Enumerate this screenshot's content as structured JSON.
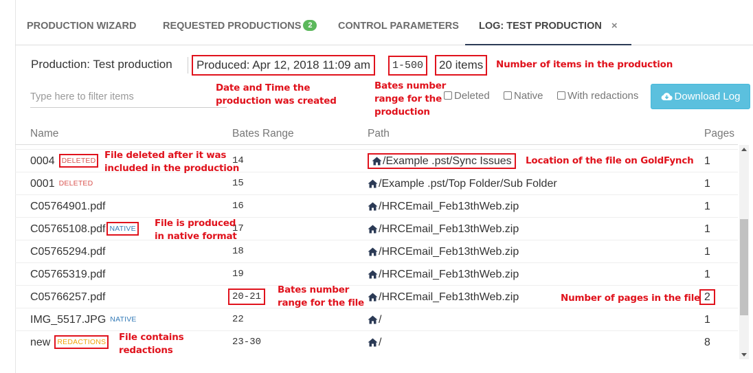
{
  "tabs": [
    {
      "label": "PRODUCTION WIZARD"
    },
    {
      "label": "REQUESTED PRODUCTIONS",
      "badge": "2"
    },
    {
      "label": "CONTROL PARAMETERS"
    },
    {
      "label": "LOG: TEST PRODUCTION",
      "close": "×"
    }
  ],
  "production": {
    "name": "Production: Test production",
    "produced": "Produced: Apr 12, 2018 11:09 am",
    "bates_range": "1-500",
    "items": "20 items"
  },
  "filter": {
    "placeholder": "Type here to filter items",
    "checkboxes": [
      "Deleted",
      "Native",
      "With redactions"
    ],
    "download_label": "Download Log"
  },
  "table": {
    "headers": {
      "name": "Name",
      "bates": "Bates Range",
      "path": "Path",
      "pages": "Pages"
    },
    "rows": [
      {
        "name": "0004",
        "tag": "DELETED",
        "bates": "14",
        "path": "/Example .pst/Sync Issues",
        "pages": "1"
      },
      {
        "name": "0001",
        "tag": "DELETED",
        "bates": "15",
        "path": "/Example .pst/Top Folder/Sub Folder",
        "pages": "1"
      },
      {
        "name": "C05764901.pdf",
        "tag": "",
        "bates": "16",
        "path": "/HRCEmail_Feb13thWeb.zip",
        "pages": "1"
      },
      {
        "name": "C05765108.pdf",
        "tag": "NATIVE",
        "bates": "17",
        "path": "/HRCEmail_Feb13thWeb.zip",
        "pages": "1"
      },
      {
        "name": "C05765294.pdf",
        "tag": "",
        "bates": "18",
        "path": "/HRCEmail_Feb13thWeb.zip",
        "pages": "1"
      },
      {
        "name": "C05765319.pdf",
        "tag": "",
        "bates": "19",
        "path": "/HRCEmail_Feb13thWeb.zip",
        "pages": "1"
      },
      {
        "name": "C05766257.pdf",
        "tag": "",
        "bates": "20-21",
        "path": "/HRCEmail_Feb13thWeb.zip",
        "pages": "2"
      },
      {
        "name": "IMG_5517.JPG",
        "tag": "NATIVE",
        "bates": "22",
        "path": "/",
        "pages": "1"
      },
      {
        "name": "new",
        "tag": "REDACTIONS",
        "bates": "23-30",
        "path": "/",
        "pages": "8"
      }
    ]
  },
  "annotations": {
    "items": "Number of items in the production",
    "date": "Date and Time the\nproduction was created",
    "bates": "Bates number\nrange for the\nproduction",
    "deleted": "File deleted after it was\nincluded in the production",
    "location": "Location of the file on GoldFynch",
    "native": "File is produced\nin native format",
    "file_bates": "Bates number\nrange for the file",
    "pages": "Number of pages in the file",
    "redactions": "File contains\nredactions"
  },
  "colors": {
    "annotation": "#e0121c",
    "download_button": "#5bc0de",
    "badge": "#5cb85c",
    "deleted": "#d9534f",
    "native": "#337ab7",
    "redactions": "#f0a30a"
  },
  "icons": {
    "home": "home-icon",
    "download": "cloud-download-icon",
    "close": "close-icon"
  }
}
